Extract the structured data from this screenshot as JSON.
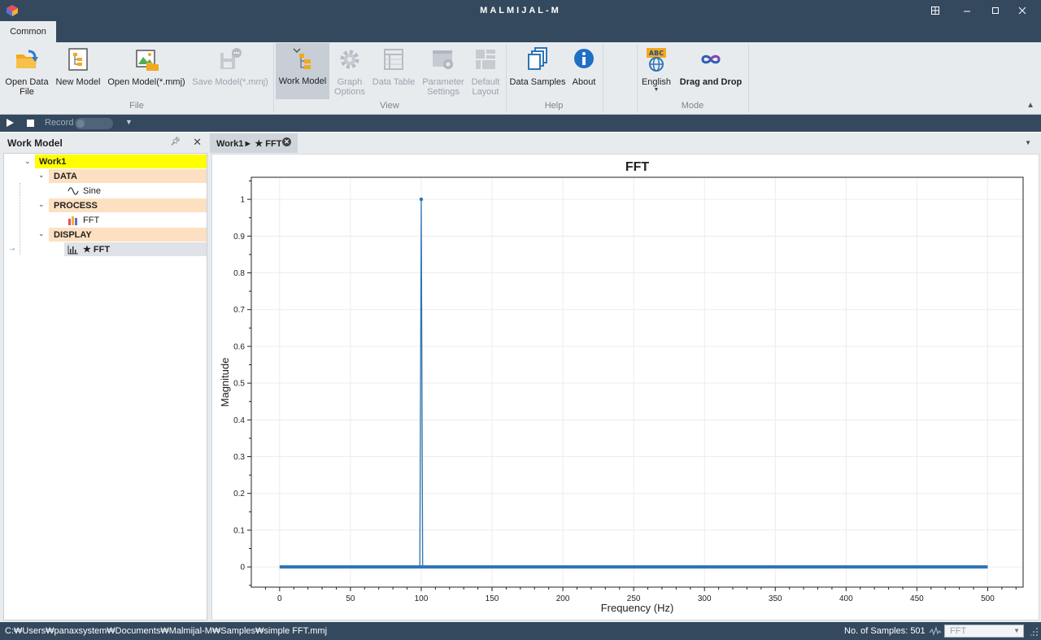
{
  "window": {
    "title": "MALMIJAL-M",
    "controls": [
      "restore-icon",
      "minimize-icon",
      "maximize-icon",
      "close-icon"
    ]
  },
  "ribbon": {
    "tab": "Common",
    "groups": {
      "file": "File",
      "view": "View",
      "help": "Help",
      "mode": "Mode"
    },
    "buttons": {
      "open_data_file": [
        "Open Data",
        "File"
      ],
      "new_model": "New Model",
      "open_model": "Open Model(*.mmj)",
      "save_model": "Save Model(*.mmj)",
      "work_model": "Work Model",
      "graph_options": [
        "Graph",
        "Options"
      ],
      "data_table": "Data Table",
      "parameter_settings": [
        "Parameter",
        "Settings"
      ],
      "default_layout": [
        "Default",
        "Layout"
      ],
      "data_samples": "Data Samples",
      "about": "About",
      "english": "English",
      "drag_and_drop": "Drag and Drop"
    },
    "icon_text": {
      "abc": "ABC"
    }
  },
  "recorder": {
    "label": "Record"
  },
  "work_model_panel": {
    "title": "Work Model",
    "root": "Work1",
    "categories": [
      {
        "label": "DATA",
        "items": [
          {
            "label": "Sine",
            "icon": "sine-wave-icon"
          }
        ]
      },
      {
        "label": "PROCESS",
        "items": [
          {
            "label": "FFT",
            "icon": "bar-chart-color-icon"
          }
        ]
      },
      {
        "label": "DISPLAY",
        "items": [
          {
            "label": "★ FFT",
            "icon": "histogram-icon"
          }
        ]
      }
    ]
  },
  "document": {
    "tab_label": "Work1► ★ FFT"
  },
  "chart_data": {
    "type": "line",
    "title": "FFT",
    "xlabel": "Frequency (Hz)",
    "ylabel": "Magnitude",
    "xlim": [
      -20,
      525
    ],
    "ylim": [
      -0.055,
      1.06
    ],
    "xticks": [
      0,
      50,
      100,
      150,
      200,
      250,
      300,
      350,
      400,
      450,
      500
    ],
    "yticks": [
      0,
      0.1,
      0.2,
      0.3,
      0.4,
      0.5,
      0.6,
      0.7,
      0.8,
      0.9,
      1
    ],
    "grid": true,
    "series": [
      {
        "color": "#2e75b6",
        "x": [
          0,
          99,
          100,
          101,
          500
        ],
        "y": [
          0,
          0,
          1,
          0,
          0
        ]
      }
    ]
  },
  "status": {
    "path": "C:₩Users₩panaxsystem₩Documents₩Malmijal-M₩Samples₩simple FFT.mmj",
    "samples": "No. of Samples: 501",
    "selector_value": "FFT"
  },
  "colors": {
    "chrome": "#34495e",
    "ribbon": "#e8ebee",
    "root_highlight": "#ffff00",
    "category_bg": "#fde0c2",
    "series": "#2e75b6"
  }
}
